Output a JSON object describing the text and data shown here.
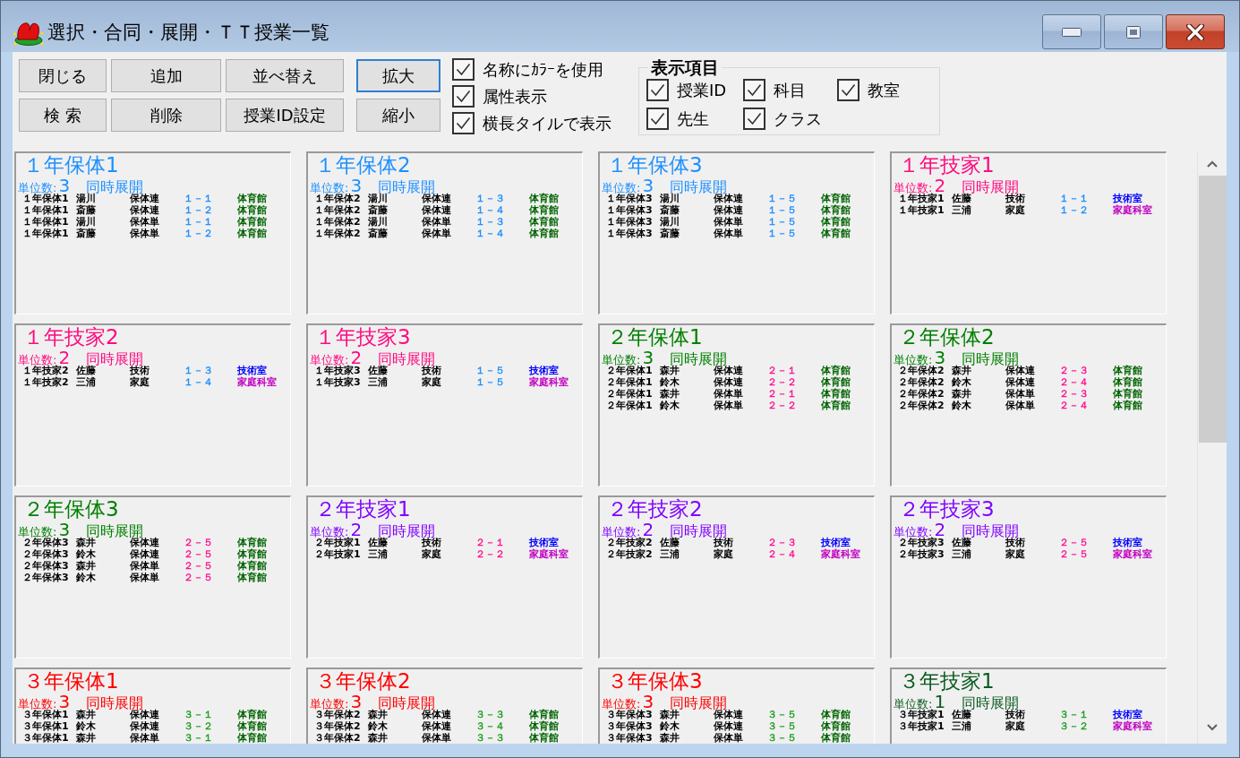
{
  "window": {
    "title": "選択・合同・展開・ＴＴ授業一覧"
  },
  "buttons": [
    {
      "label": "閉じる",
      "focused": false
    },
    {
      "label": "追加",
      "focused": false
    },
    {
      "label": "並べ替え",
      "focused": false
    },
    {
      "label": "検 索",
      "focused": false
    },
    {
      "label": "削除",
      "focused": false
    },
    {
      "label": "授業ID設定",
      "focused": false
    }
  ],
  "zoom_buttons": [
    {
      "label": "拡大",
      "focused": true
    },
    {
      "label": "縮小",
      "focused": false
    }
  ],
  "options": [
    {
      "label": "名称にｶﾗｰを使用",
      "checked": true
    },
    {
      "label": "属性表示",
      "checked": true
    },
    {
      "label": "横長タイルで表示",
      "checked": true
    }
  ],
  "display_items": {
    "title": "表示項目",
    "items": [
      {
        "label": "授業ID",
        "checked": true
      },
      {
        "label": "科目",
        "checked": true
      },
      {
        "label": "教室",
        "checked": true
      },
      {
        "label": "先生",
        "checked": true
      },
      {
        "label": "クラス",
        "checked": true
      }
    ]
  },
  "tiles": [
    {
      "title": "１年保体1",
      "color": "#1e90ff",
      "units_label": "単位数:",
      "units": "3",
      "mode": "同時展開",
      "rows": [
        {
          "name": "１年保体1",
          "teacher": "湯川",
          "subject": "保体連",
          "class": {
            "text": "１－１",
            "color": "#1e90ff"
          },
          "room": {
            "text": "体育館",
            "color": "#006400"
          }
        },
        {
          "name": "１年保体1",
          "teacher": "斎藤",
          "subject": "保体連",
          "class": {
            "text": "１－２",
            "color": "#1e90ff"
          },
          "room": {
            "text": "体育館",
            "color": "#006400"
          }
        },
        {
          "name": "１年保体1",
          "teacher": "湯川",
          "subject": "保体単",
          "class": {
            "text": "１－１",
            "color": "#1e90ff"
          },
          "room": {
            "text": "体育館",
            "color": "#006400"
          }
        },
        {
          "name": "１年保体1",
          "teacher": "斎藤",
          "subject": "保体単",
          "class": {
            "text": "１－２",
            "color": "#1e90ff"
          },
          "room": {
            "text": "体育館",
            "color": "#006400"
          }
        }
      ]
    },
    {
      "title": "１年保体2",
      "color": "#1e90ff",
      "units_label": "単位数:",
      "units": "3",
      "mode": "同時展開",
      "rows": [
        {
          "name": "１年保体2",
          "teacher": "湯川",
          "subject": "保体連",
          "class": {
            "text": "１－３",
            "color": "#1e90ff"
          },
          "room": {
            "text": "体育館",
            "color": "#006400"
          }
        },
        {
          "name": "１年保体2",
          "teacher": "斎藤",
          "subject": "保体連",
          "class": {
            "text": "１－４",
            "color": "#1e90ff"
          },
          "room": {
            "text": "体育館",
            "color": "#006400"
          }
        },
        {
          "name": "１年保体2",
          "teacher": "湯川",
          "subject": "保体単",
          "class": {
            "text": "１－３",
            "color": "#1e90ff"
          },
          "room": {
            "text": "体育館",
            "color": "#006400"
          }
        },
        {
          "name": "１年保体2",
          "teacher": "斎藤",
          "subject": "保体単",
          "class": {
            "text": "１－４",
            "color": "#1e90ff"
          },
          "room": {
            "text": "体育館",
            "color": "#006400"
          }
        }
      ]
    },
    {
      "title": "１年保体3",
      "color": "#1e90ff",
      "units_label": "単位数:",
      "units": "3",
      "mode": "同時展開",
      "rows": [
        {
          "name": "１年保体3",
          "teacher": "湯川",
          "subject": "保体連",
          "class": {
            "text": "１－５",
            "color": "#1e90ff"
          },
          "room": {
            "text": "体育館",
            "color": "#006400"
          }
        },
        {
          "name": "１年保体3",
          "teacher": "斎藤",
          "subject": "保体連",
          "class": {
            "text": "１－５",
            "color": "#1e90ff"
          },
          "room": {
            "text": "体育館",
            "color": "#006400"
          }
        },
        {
          "name": "１年保体3",
          "teacher": "湯川",
          "subject": "保体単",
          "class": {
            "text": "１－５",
            "color": "#1e90ff"
          },
          "room": {
            "text": "体育館",
            "color": "#006400"
          }
        },
        {
          "name": "１年保体3",
          "teacher": "斎藤",
          "subject": "保体単",
          "class": {
            "text": "１－５",
            "color": "#1e90ff"
          },
          "room": {
            "text": "体育館",
            "color": "#006400"
          }
        }
      ]
    },
    {
      "title": "１年技家1",
      "color": "#ff0a80",
      "units_label": "単位数:",
      "units": "2",
      "mode": "同時展開",
      "rows": [
        {
          "name": "１年技家1",
          "teacher": "佐藤",
          "subject": "技術",
          "class": {
            "text": "１－１",
            "color": "#1e90ff"
          },
          "room": {
            "text": "技術室",
            "color": "#0000ff"
          }
        },
        {
          "name": "１年技家1",
          "teacher": "三浦",
          "subject": "家庭",
          "class": {
            "text": "１－２",
            "color": "#1e90ff"
          },
          "room": {
            "text": "家庭科室",
            "color": "#c000c0"
          }
        }
      ]
    },
    {
      "title": "１年技家2",
      "color": "#ff0a80",
      "units_label": "単位数:",
      "units": "2",
      "mode": "同時展開",
      "rows": [
        {
          "name": "１年技家2",
          "teacher": "佐藤",
          "subject": "技術",
          "class": {
            "text": "１－３",
            "color": "#1e90ff"
          },
          "room": {
            "text": "技術室",
            "color": "#0000ff"
          }
        },
        {
          "name": "１年技家2",
          "teacher": "三浦",
          "subject": "家庭",
          "class": {
            "text": "１－４",
            "color": "#1e90ff"
          },
          "room": {
            "text": "家庭科室",
            "color": "#c000c0"
          }
        }
      ]
    },
    {
      "title": "１年技家3",
      "color": "#ff0a80",
      "units_label": "単位数:",
      "units": "2",
      "mode": "同時展開",
      "rows": [
        {
          "name": "１年技家3",
          "teacher": "佐藤",
          "subject": "技術",
          "class": {
            "text": "１－５",
            "color": "#1e90ff"
          },
          "room": {
            "text": "技術室",
            "color": "#0000ff"
          }
        },
        {
          "name": "１年技家3",
          "teacher": "三浦",
          "subject": "家庭",
          "class": {
            "text": "１－５",
            "color": "#1e90ff"
          },
          "room": {
            "text": "家庭科室",
            "color": "#c000c0"
          }
        }
      ]
    },
    {
      "title": "２年保体1",
      "color": "#008000",
      "units_label": "単位数:",
      "units": "3",
      "mode": "同時展開",
      "rows": [
        {
          "name": "２年保体1",
          "teacher": "森井",
          "subject": "保体連",
          "class": {
            "text": "２－１",
            "color": "#ff1493"
          },
          "room": {
            "text": "体育館",
            "color": "#006400"
          }
        },
        {
          "name": "２年保体1",
          "teacher": "鈴木",
          "subject": "保体連",
          "class": {
            "text": "２－２",
            "color": "#ff1493"
          },
          "room": {
            "text": "体育館",
            "color": "#006400"
          }
        },
        {
          "name": "２年保体1",
          "teacher": "森井",
          "subject": "保体単",
          "class": {
            "text": "２－１",
            "color": "#ff1493"
          },
          "room": {
            "text": "体育館",
            "color": "#006400"
          }
        },
        {
          "name": "２年保体1",
          "teacher": "鈴木",
          "subject": "保体単",
          "class": {
            "text": "２－２",
            "color": "#ff1493"
          },
          "room": {
            "text": "体育館",
            "color": "#006400"
          }
        }
      ]
    },
    {
      "title": "２年保体2",
      "color": "#008000",
      "units_label": "単位数:",
      "units": "3",
      "mode": "同時展開",
      "rows": [
        {
          "name": "２年保体2",
          "teacher": "森井",
          "subject": "保体連",
          "class": {
            "text": "２－３",
            "color": "#ff1493"
          },
          "room": {
            "text": "体育館",
            "color": "#006400"
          }
        },
        {
          "name": "２年保体2",
          "teacher": "鈴木",
          "subject": "保体連",
          "class": {
            "text": "２－４",
            "color": "#ff1493"
          },
          "room": {
            "text": "体育館",
            "color": "#006400"
          }
        },
        {
          "name": "２年保体2",
          "teacher": "森井",
          "subject": "保体単",
          "class": {
            "text": "２－３",
            "color": "#ff1493"
          },
          "room": {
            "text": "体育館",
            "color": "#006400"
          }
        },
        {
          "name": "２年保体2",
          "teacher": "鈴木",
          "subject": "保体単",
          "class": {
            "text": "２－４",
            "color": "#ff1493"
          },
          "room": {
            "text": "体育館",
            "color": "#006400"
          }
        }
      ]
    },
    {
      "title": "２年保体3",
      "color": "#008000",
      "units_label": "単位数:",
      "units": "3",
      "mode": "同時展開",
      "rows": [
        {
          "name": "２年保体3",
          "teacher": "森井",
          "subject": "保体連",
          "class": {
            "text": "２－５",
            "color": "#ff1493"
          },
          "room": {
            "text": "体育館",
            "color": "#006400"
          }
        },
        {
          "name": "２年保体3",
          "teacher": "鈴木",
          "subject": "保体連",
          "class": {
            "text": "２－５",
            "color": "#ff1493"
          },
          "room": {
            "text": "体育館",
            "color": "#006400"
          }
        },
        {
          "name": "２年保体3",
          "teacher": "森井",
          "subject": "保体単",
          "class": {
            "text": "２－５",
            "color": "#ff1493"
          },
          "room": {
            "text": "体育館",
            "color": "#006400"
          }
        },
        {
          "name": "２年保体3",
          "teacher": "鈴木",
          "subject": "保体単",
          "class": {
            "text": "２－５",
            "color": "#ff1493"
          },
          "room": {
            "text": "体育館",
            "color": "#006400"
          }
        }
      ]
    },
    {
      "title": "２年技家1",
      "color": "#8000ff",
      "units_label": "単位数:",
      "units": "2",
      "mode": "同時展開",
      "rows": [
        {
          "name": "２年技家1",
          "teacher": "佐藤",
          "subject": "技術",
          "class": {
            "text": "２－１",
            "color": "#ff1493"
          },
          "room": {
            "text": "技術室",
            "color": "#0000ff"
          }
        },
        {
          "name": "２年技家1",
          "teacher": "三浦",
          "subject": "家庭",
          "class": {
            "text": "２－２",
            "color": "#ff1493"
          },
          "room": {
            "text": "家庭科室",
            "color": "#c000c0"
          }
        }
      ]
    },
    {
      "title": "２年技家2",
      "color": "#8000ff",
      "units_label": "単位数:",
      "units": "2",
      "mode": "同時展開",
      "rows": [
        {
          "name": "２年技家2",
          "teacher": "佐藤",
          "subject": "技術",
          "class": {
            "text": "２－３",
            "color": "#ff1493"
          },
          "room": {
            "text": "技術室",
            "color": "#0000ff"
          }
        },
        {
          "name": "２年技家2",
          "teacher": "三浦",
          "subject": "家庭",
          "class": {
            "text": "２－４",
            "color": "#ff1493"
          },
          "room": {
            "text": "家庭科室",
            "color": "#c000c0"
          }
        }
      ]
    },
    {
      "title": "２年技家3",
      "color": "#8000ff",
      "units_label": "単位数:",
      "units": "2",
      "mode": "同時展開",
      "rows": [
        {
          "name": "２年技家3",
          "teacher": "佐藤",
          "subject": "技術",
          "class": {
            "text": "２－５",
            "color": "#ff1493"
          },
          "room": {
            "text": "技術室",
            "color": "#0000ff"
          }
        },
        {
          "name": "２年技家3",
          "teacher": "三浦",
          "subject": "家庭",
          "class": {
            "text": "２－５",
            "color": "#ff1493"
          },
          "room": {
            "text": "家庭科室",
            "color": "#c000c0"
          }
        }
      ]
    },
    {
      "title": "３年保体1",
      "color": "#ff0000",
      "units_label": "単位数:",
      "units": "3",
      "mode": "同時展開",
      "rows": [
        {
          "name": "３年保体1",
          "teacher": "森井",
          "subject": "保体連",
          "class": {
            "text": "３－１",
            "color": "#20a020"
          },
          "room": {
            "text": "体育館",
            "color": "#006400"
          }
        },
        {
          "name": "３年保体1",
          "teacher": "鈴木",
          "subject": "保体連",
          "class": {
            "text": "３－２",
            "color": "#20a020"
          },
          "room": {
            "text": "体育館",
            "color": "#006400"
          }
        },
        {
          "name": "３年保体1",
          "teacher": "森井",
          "subject": "保体単",
          "class": {
            "text": "３－１",
            "color": "#20a020"
          },
          "room": {
            "text": "体育館",
            "color": "#006400"
          }
        }
      ]
    },
    {
      "title": "３年保体2",
      "color": "#ff0000",
      "units_label": "単位数:",
      "units": "3",
      "mode": "同時展開",
      "rows": [
        {
          "name": "３年保体2",
          "teacher": "森井",
          "subject": "保体連",
          "class": {
            "text": "３－３",
            "color": "#20a020"
          },
          "room": {
            "text": "体育館",
            "color": "#006400"
          }
        },
        {
          "name": "３年保体2",
          "teacher": "鈴木",
          "subject": "保体連",
          "class": {
            "text": "３－４",
            "color": "#20a020"
          },
          "room": {
            "text": "体育館",
            "color": "#006400"
          }
        },
        {
          "name": "３年保体2",
          "teacher": "森井",
          "subject": "保体単",
          "class": {
            "text": "３－３",
            "color": "#20a020"
          },
          "room": {
            "text": "体育館",
            "color": "#006400"
          }
        }
      ]
    },
    {
      "title": "３年保体3",
      "color": "#ff0000",
      "units_label": "単位数:",
      "units": "3",
      "mode": "同時展開",
      "rows": [
        {
          "name": "３年保体3",
          "teacher": "森井",
          "subject": "保体連",
          "class": {
            "text": "３－５",
            "color": "#20a020"
          },
          "room": {
            "text": "体育館",
            "color": "#006400"
          }
        },
        {
          "name": "３年保体3",
          "teacher": "鈴木",
          "subject": "保体連",
          "class": {
            "text": "３－５",
            "color": "#20a020"
          },
          "room": {
            "text": "体育館",
            "color": "#006400"
          }
        },
        {
          "name": "３年保体3",
          "teacher": "森井",
          "subject": "保体単",
          "class": {
            "text": "３－５",
            "color": "#20a020"
          },
          "room": {
            "text": "体育館",
            "color": "#006400"
          }
        }
      ]
    },
    {
      "title": "３年技家1",
      "color": "#0a5a20",
      "units_label": "単位数:",
      "units": "1",
      "mode": "同時展開",
      "rows": [
        {
          "name": "３年技家1",
          "teacher": "佐藤",
          "subject": "技術",
          "class": {
            "text": "３－１",
            "color": "#20a020"
          },
          "room": {
            "text": "技術室",
            "color": "#0000ff"
          }
        },
        {
          "name": "３年技家1",
          "teacher": "三浦",
          "subject": "家庭",
          "class": {
            "text": "３－２",
            "color": "#20a020"
          },
          "room": {
            "text": "家庭科室",
            "color": "#c000c0"
          }
        }
      ]
    }
  ]
}
